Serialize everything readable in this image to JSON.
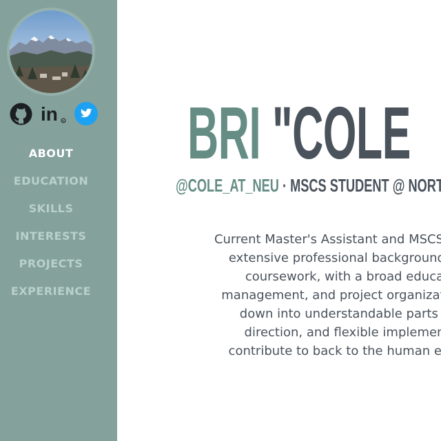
{
  "sidebar": {
    "avatar_alt": "Mountain landscape profile photo",
    "social": [
      {
        "name": "github",
        "icon": "github-icon",
        "label": "GitHub"
      },
      {
        "name": "linkedin",
        "icon": "linkedin-icon",
        "label": "LinkedIn"
      },
      {
        "name": "twitter",
        "icon": "twitter-icon",
        "label": "Twitter"
      }
    ],
    "nav": [
      {
        "label": "ABOUT",
        "active": true
      },
      {
        "label": "EDUCATION",
        "active": false
      },
      {
        "label": "SKILLS",
        "active": false
      },
      {
        "label": "INTERESTS",
        "active": false
      },
      {
        "label": "PROJECTS",
        "active": false
      },
      {
        "label": "EXPERIENCE",
        "active": false
      }
    ],
    "colors": {
      "background": "#84a19c",
      "nav_active": "#ffffff",
      "nav_inactive": "#b9d0cc",
      "twitter": "#1da1f2"
    }
  },
  "main": {
    "headline": {
      "first": "BRI",
      "nick": "\"COLE"
    },
    "subheading": {
      "handle": "@COLE_AT_NEU",
      "separator": " · ",
      "title": "MSCS STUDENT @ NORT"
    },
    "bio_lines": [
      "Current Master's Assistant and MSCS stud",
      "extensive professional background in",
      "coursework, with a broad educa",
      "management, and project organization.",
      "down into understandable parts v",
      "direction, and flexible implemen",
      "contribute to back to the human elen"
    ],
    "colors": {
      "accent": "#658d84",
      "text_dark": "#4a525c"
    }
  }
}
